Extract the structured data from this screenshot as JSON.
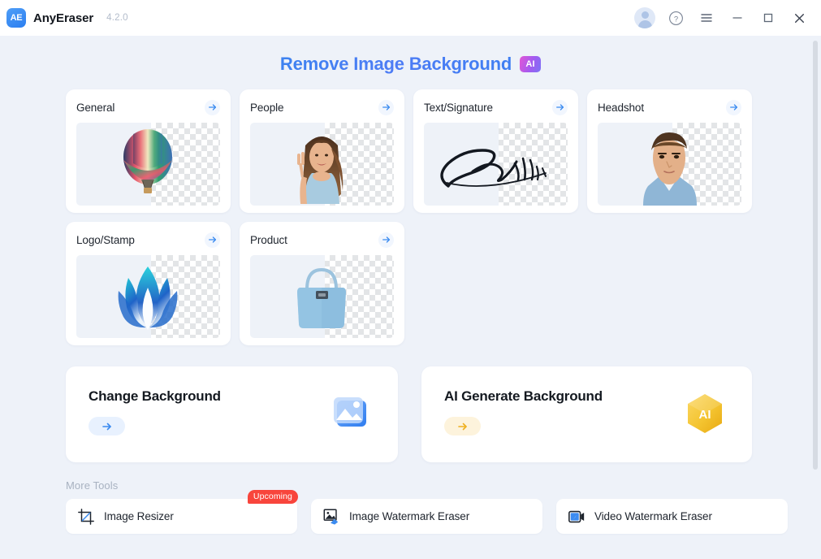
{
  "titlebar": {
    "logo_text": "AE",
    "app_name": "AnyEraser",
    "version": "4.2.0",
    "controls": [
      {
        "name": "account-avatar",
        "label": ""
      },
      {
        "name": "help-icon",
        "label": "?"
      },
      {
        "name": "menu-icon",
        "label": ""
      },
      {
        "name": "minimize-icon",
        "label": ""
      },
      {
        "name": "maximize-icon",
        "label": ""
      },
      {
        "name": "close-icon",
        "label": ""
      }
    ]
  },
  "page": {
    "title": "Remove Image Background",
    "ai_badge": "AI"
  },
  "cards": [
    {
      "title": "General",
      "art": "balloon"
    },
    {
      "title": "People",
      "art": "woman"
    },
    {
      "title": "Text/Signature",
      "art": "signature"
    },
    {
      "title": "Headshot",
      "art": "man"
    },
    {
      "title": "Logo/Stamp",
      "art": "logo"
    },
    {
      "title": "Product",
      "art": "bag"
    }
  ],
  "features": [
    {
      "title": "Change Background",
      "icon": "image-icon",
      "accent": "#3b82f6"
    },
    {
      "title": "AI Generate Background",
      "icon": "ai-hex-icon",
      "accent": "#f5c431"
    }
  ],
  "more_tools": {
    "label": "More Tools",
    "items": [
      {
        "title": "Image Resizer",
        "icon": "crop-icon",
        "badge": "Upcoming"
      },
      {
        "title": "Image Watermark Eraser",
        "icon": "image-eraser-icon",
        "badge": ""
      },
      {
        "title": "Video Watermark Eraser",
        "icon": "video-eraser-icon",
        "badge": ""
      }
    ]
  },
  "colors": {
    "app_background": "#eef2f9",
    "card_background": "#ffffff",
    "accent_blue": "#3b82f6",
    "accent_amber": "#f5c431",
    "badge_red": "#f8453c"
  }
}
